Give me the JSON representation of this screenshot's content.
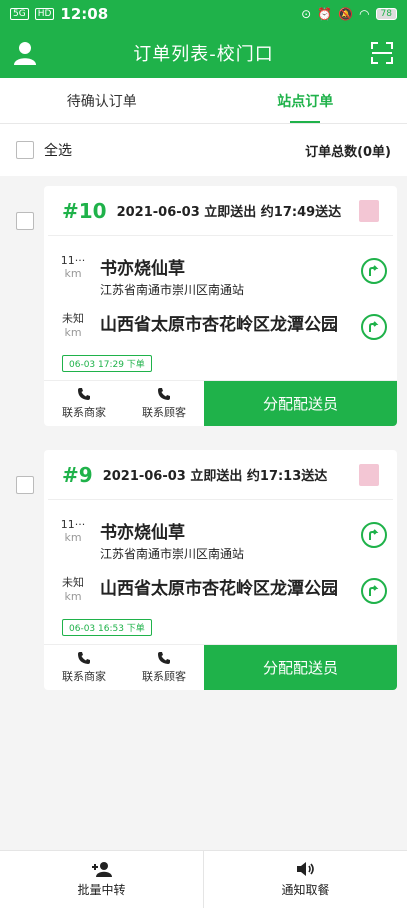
{
  "status": {
    "signal": "5G",
    "hd": "HD",
    "time": "12:08",
    "battery": "78"
  },
  "header": {
    "title": "订单列表-校门口"
  },
  "tabs": [
    {
      "label": "待确认订单",
      "active": false
    },
    {
      "label": "站点订单",
      "active": true
    }
  ],
  "select_bar": {
    "select_all": "全选",
    "total": "订单总数(0单)"
  },
  "orders": [
    {
      "number": "#10",
      "info": "2021-06-03 立即送出 约17:49送达",
      "pickup": {
        "distance": "11···",
        "unit": "km",
        "name": "书亦烧仙草",
        "address": "江苏省南通市崇川区南通站"
      },
      "dropoff": {
        "distance": "未知",
        "unit": "km",
        "address": "山西省太原市杏花岭区龙潭公园"
      },
      "order_time": "06-03 17:29 下单",
      "contact_merchant": "联系商家",
      "contact_customer": "联系顾客",
      "assign": "分配配送员"
    },
    {
      "number": "#9",
      "info": "2021-06-03 立即送出 约17:13送达",
      "pickup": {
        "distance": "11···",
        "unit": "km",
        "name": "书亦烧仙草",
        "address": "江苏省南通市崇川区南通站"
      },
      "dropoff": {
        "distance": "未知",
        "unit": "km",
        "address": "山西省太原市杏花岭区龙潭公园"
      },
      "order_time": "06-03 16:53 下单",
      "contact_merchant": "联系商家",
      "contact_customer": "联系顾客",
      "assign": "分配配送员"
    }
  ],
  "bottom": {
    "transfer": "批量中转",
    "notify": "通知取餐"
  },
  "colors": {
    "accent": "#1fb24a"
  },
  "icons": [
    "user-icon",
    "scan-icon",
    "navigate-icon",
    "phone-icon",
    "add-user-icon",
    "speaker-icon"
  ]
}
